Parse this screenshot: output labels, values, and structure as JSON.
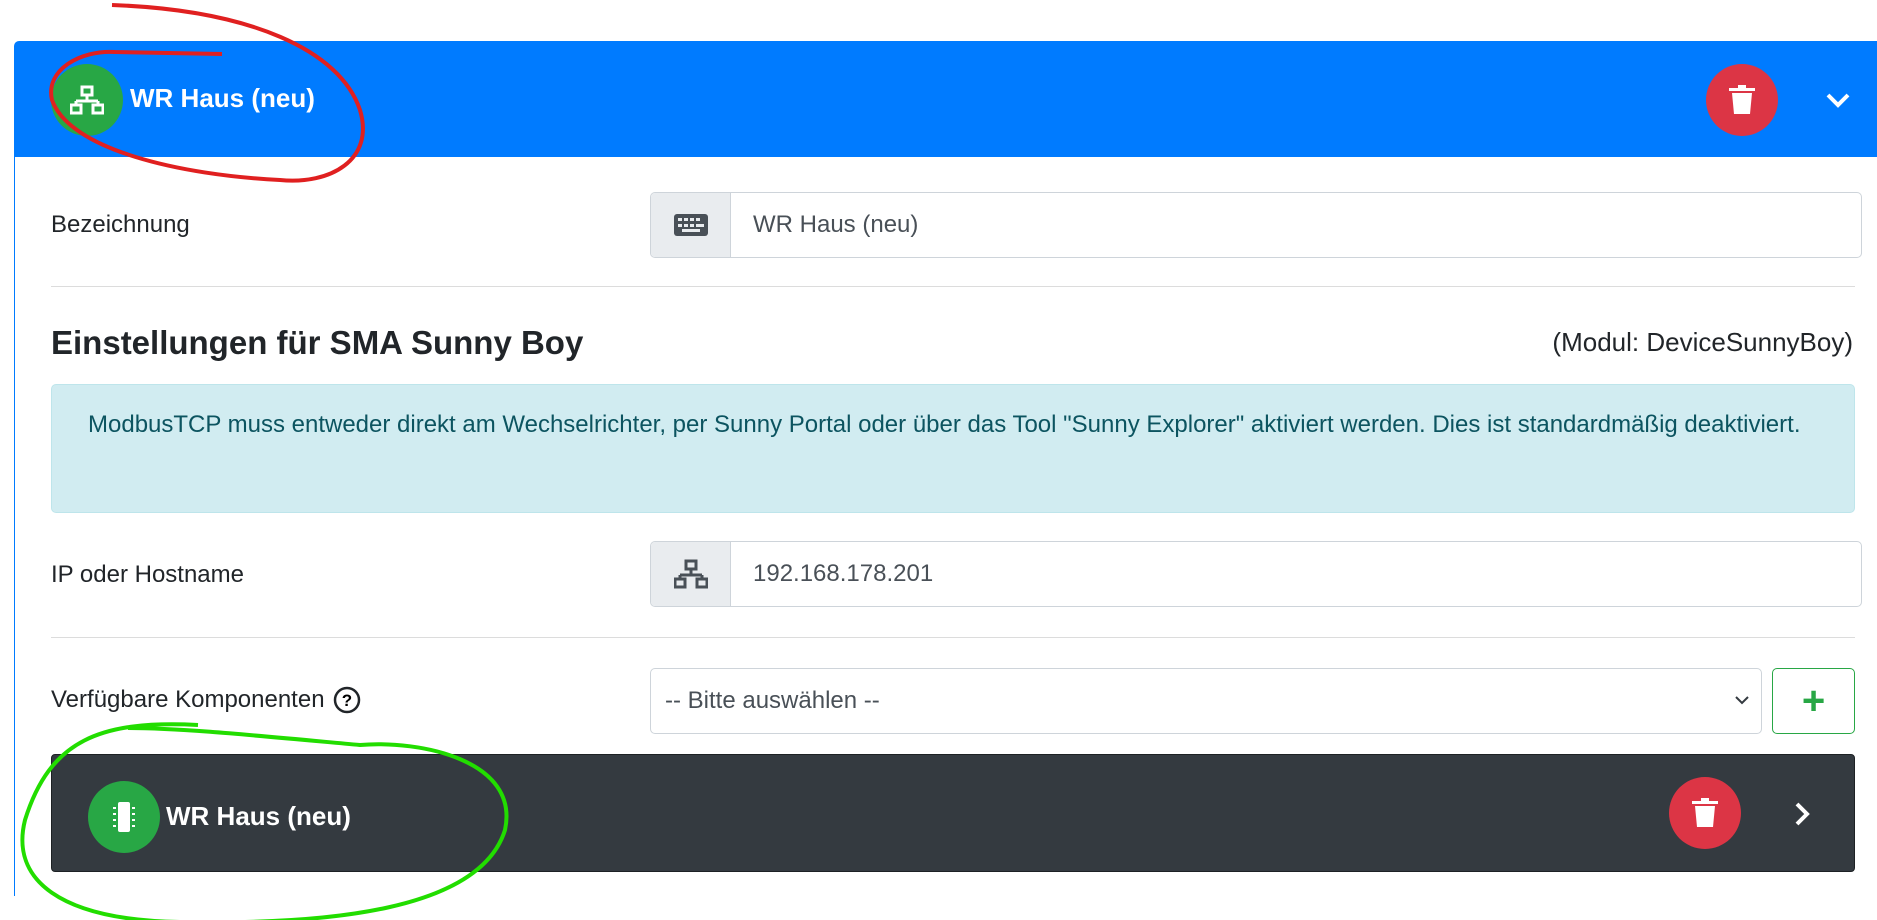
{
  "header": {
    "title": "WR Haus (neu)",
    "icon": "network-icon",
    "delete_icon": "trash-icon",
    "toggle_icon": "chevron-down-icon"
  },
  "form": {
    "name_label": "Bezeichnung",
    "name_value": "WR Haus (neu)",
    "name_icon": "keyboard-icon",
    "section_title": "Einstellungen für SMA Sunny Boy",
    "module": "(Modul: DeviceSunnyBoy)",
    "alert": "ModbusTCP muss entweder direkt am Wechselrichter, per Sunny Portal oder über das Tool \"Sunny Explorer\" aktiviert werden. Dies ist standardmäßig deaktiviert.",
    "ip_label": "IP oder Hostname",
    "ip_value": "192.168.178.201",
    "ip_icon": "network-icon",
    "components_label": "Verfügbare Komponenten",
    "components_select": "-- Bitte auswählen --",
    "add_label": "+"
  },
  "component": {
    "title": "WR Haus (neu)",
    "icon": "chip-icon",
    "delete_icon": "trash-icon",
    "expand_icon": "chevron-right-icon"
  },
  "colors": {
    "primary": "#007bff",
    "success": "#28a745",
    "danger": "#dc3545",
    "dark": "#343a40",
    "info_bg": "#d1ecf1"
  }
}
